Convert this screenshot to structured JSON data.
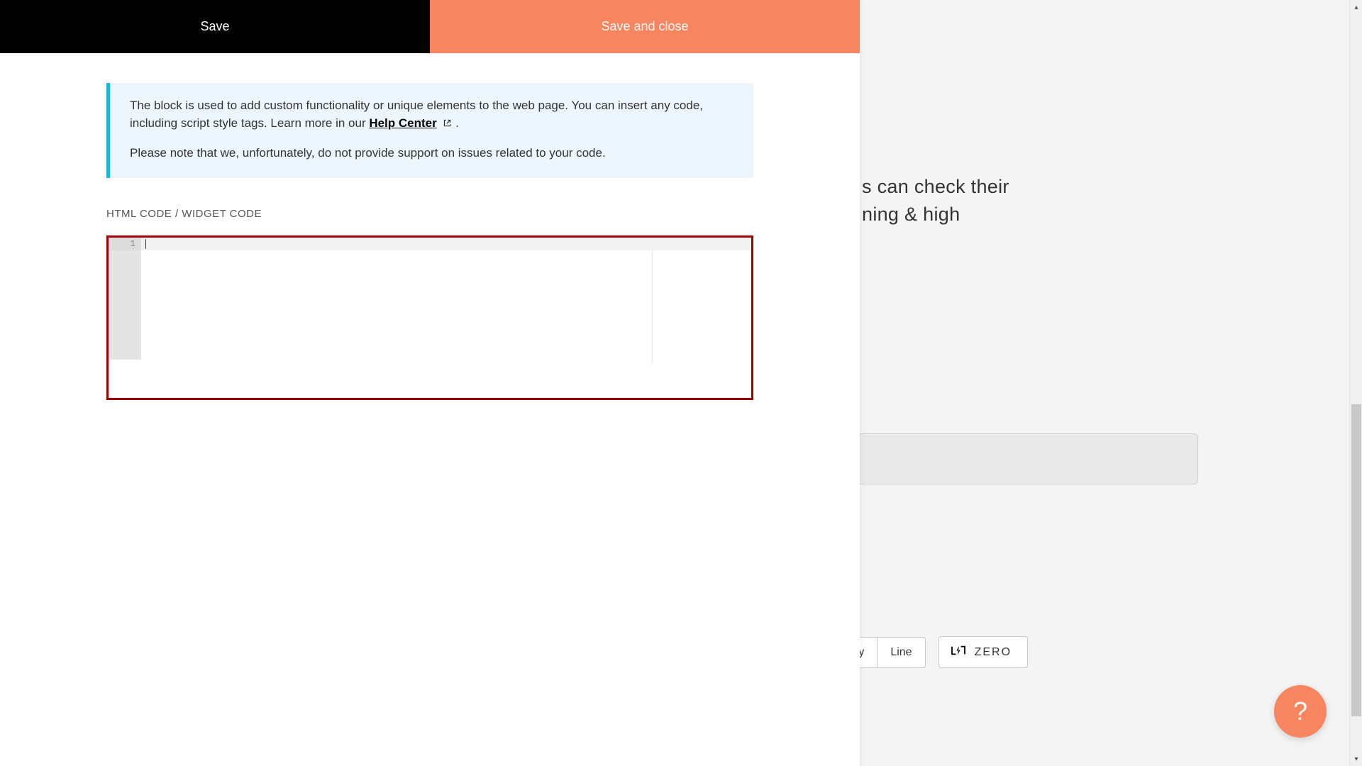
{
  "topbar": {
    "save_label": "Save",
    "save_close_label": "Save and close"
  },
  "info": {
    "paragraph1_prefix": "The block is used to add custom functionality or unique elements to the web page. You can insert any code, including script style tags. Learn more in our ",
    "help_link_label": "Help Center",
    "paragraph1_suffix": " .",
    "paragraph2": "Please note that we, unfortunately, do not provide support on issues related to your code."
  },
  "section": {
    "code_label": "HTML CODE / WIDGET CODE"
  },
  "editor": {
    "line_number_1": "1"
  },
  "bg": {
    "line1": "s can check their",
    "line2": "ning & high"
  },
  "pills": {
    "partial": "ry",
    "line": "Line",
    "zero": "ZERO"
  },
  "help_fab": {
    "label": "?"
  }
}
